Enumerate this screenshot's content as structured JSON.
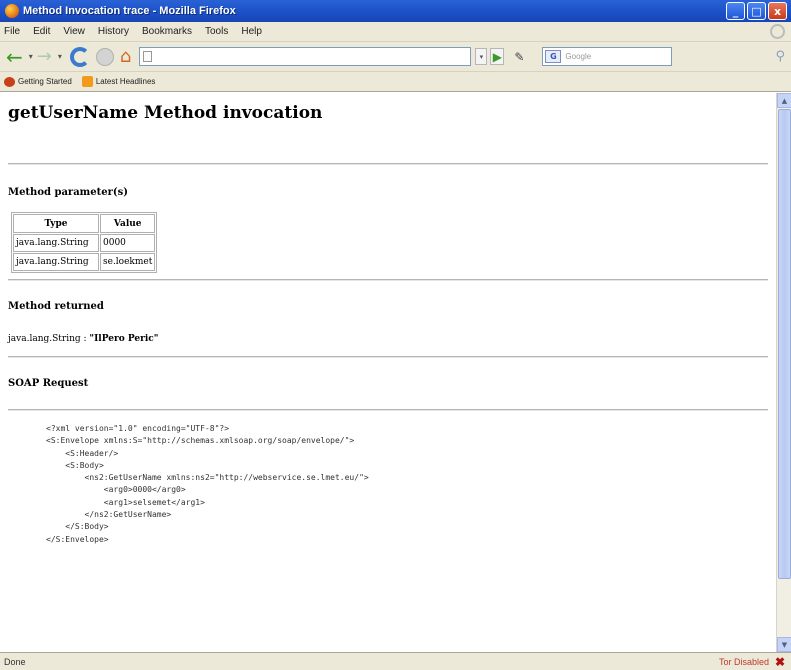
{
  "window": {
    "title": "Method Invocation trace - Mozilla Firefox",
    "buttons": {
      "minimize": "_",
      "maximize": "□",
      "close": "x"
    }
  },
  "menu": [
    "File",
    "Edit",
    "View",
    "History",
    "Bookmarks",
    "Tools",
    "Help"
  ],
  "toolbar": {
    "url": "",
    "search_placeholder": "Google",
    "search_engine_label": "G"
  },
  "bookmarks": [
    "Getting Started",
    "Latest Headlines"
  ],
  "page": {
    "title": "getUserName Method invocation",
    "params_heading": "Method parameter(s)",
    "params_table": {
      "headers": [
        "Type",
        "Value"
      ],
      "rows": [
        [
          "java.lang.String",
          "0000"
        ],
        [
          "java.lang.String",
          "se.loekmet"
        ]
      ]
    },
    "returned_heading": "Method returned",
    "returned_type": "java.lang.String : ",
    "returned_value": "\"IlPero Peric\"",
    "soap_heading": "SOAP Request",
    "soap_xml": [
      "<?xml version=\"1.0\" encoding=\"UTF-8\"?>",
      "<S:Envelope xmlns:S=\"http://schemas.xmlsoap.org/soap/envelope/\">",
      "    <S:Header/>",
      "    <S:Body>",
      "        <ns2:GetUserName xmlns:ns2=\"http://webservice.se.lmet.eu/\">",
      "            <arg0>0000</arg0>",
      "            <arg1>selsemet</arg1>",
      "        </ns2:GetUserName>",
      "    </S:Body>",
      "</S:Envelope>"
    ]
  },
  "status": {
    "text": "Done",
    "tor": "Tor Disabled"
  }
}
